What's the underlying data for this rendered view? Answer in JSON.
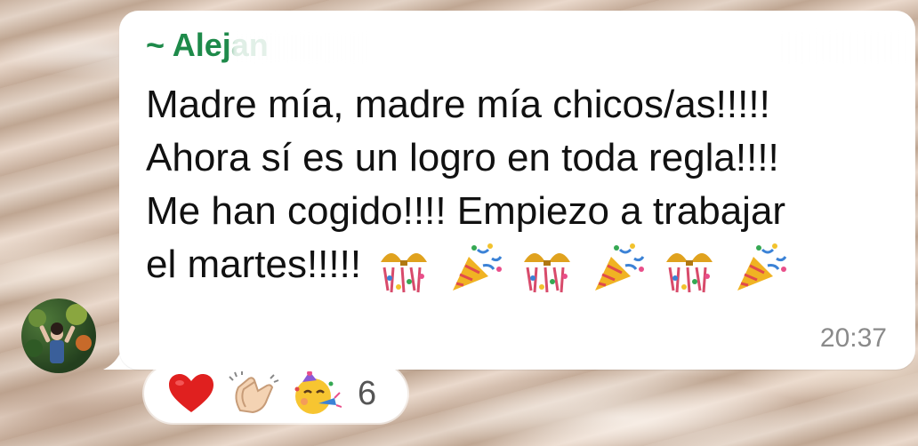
{
  "message": {
    "sender_partial": "~ Alejan",
    "lines": [
      "Madre mía, madre mía chicos/as!!!!!",
      "Ahora sí es un logro en toda regla!!!!",
      "Me han cogido!!!! Empiezo a trabajar",
      "el martes!!!!!"
    ],
    "trailing_emojis": [
      "confetti-ball-icon",
      "party-popper-icon",
      "confetti-ball-icon",
      "party-popper-icon",
      "confetti-ball-icon",
      "party-popper-icon"
    ],
    "time": "20:37"
  },
  "reactions": {
    "emojis": [
      "red-heart-icon",
      "clapping-hands-icon",
      "partying-face-icon"
    ],
    "count": "6"
  },
  "colors": {
    "sender_name": "#1e8a4a",
    "bubble": "#ffffff",
    "timestamp": "#8a8a8a"
  }
}
